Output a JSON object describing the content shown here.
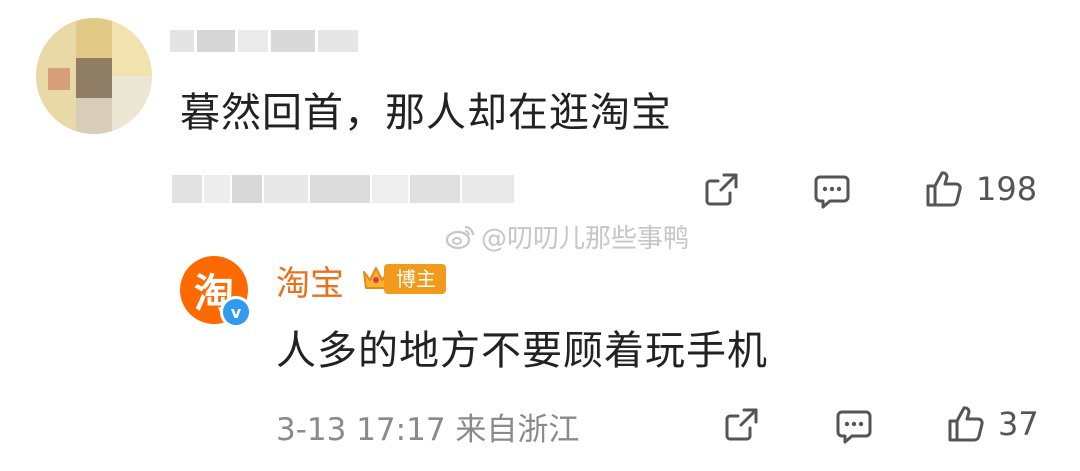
{
  "comment": {
    "text": "暮然回首，那人却在逛淘宝",
    "share_icon": "share-icon",
    "reply_icon": "comment-icon",
    "like_icon": "thumbs-up-icon",
    "like_count": "198"
  },
  "watermark": {
    "icon": "weibo-icon",
    "text": "@叨叨儿那些事鸭"
  },
  "reply": {
    "author": "淘宝",
    "avatar_glyph": "淘",
    "verified_mark": "v",
    "badge": "博主",
    "text": "人多的地方不要顾着玩手机",
    "time": "3-13 17:17 来自浙江",
    "like_count": "37"
  },
  "colors": {
    "brand_orange": "#ff6a00",
    "name_orange": "#e8711b",
    "badge_orange": "#f29a1b",
    "verified_blue": "#2f9af0"
  }
}
